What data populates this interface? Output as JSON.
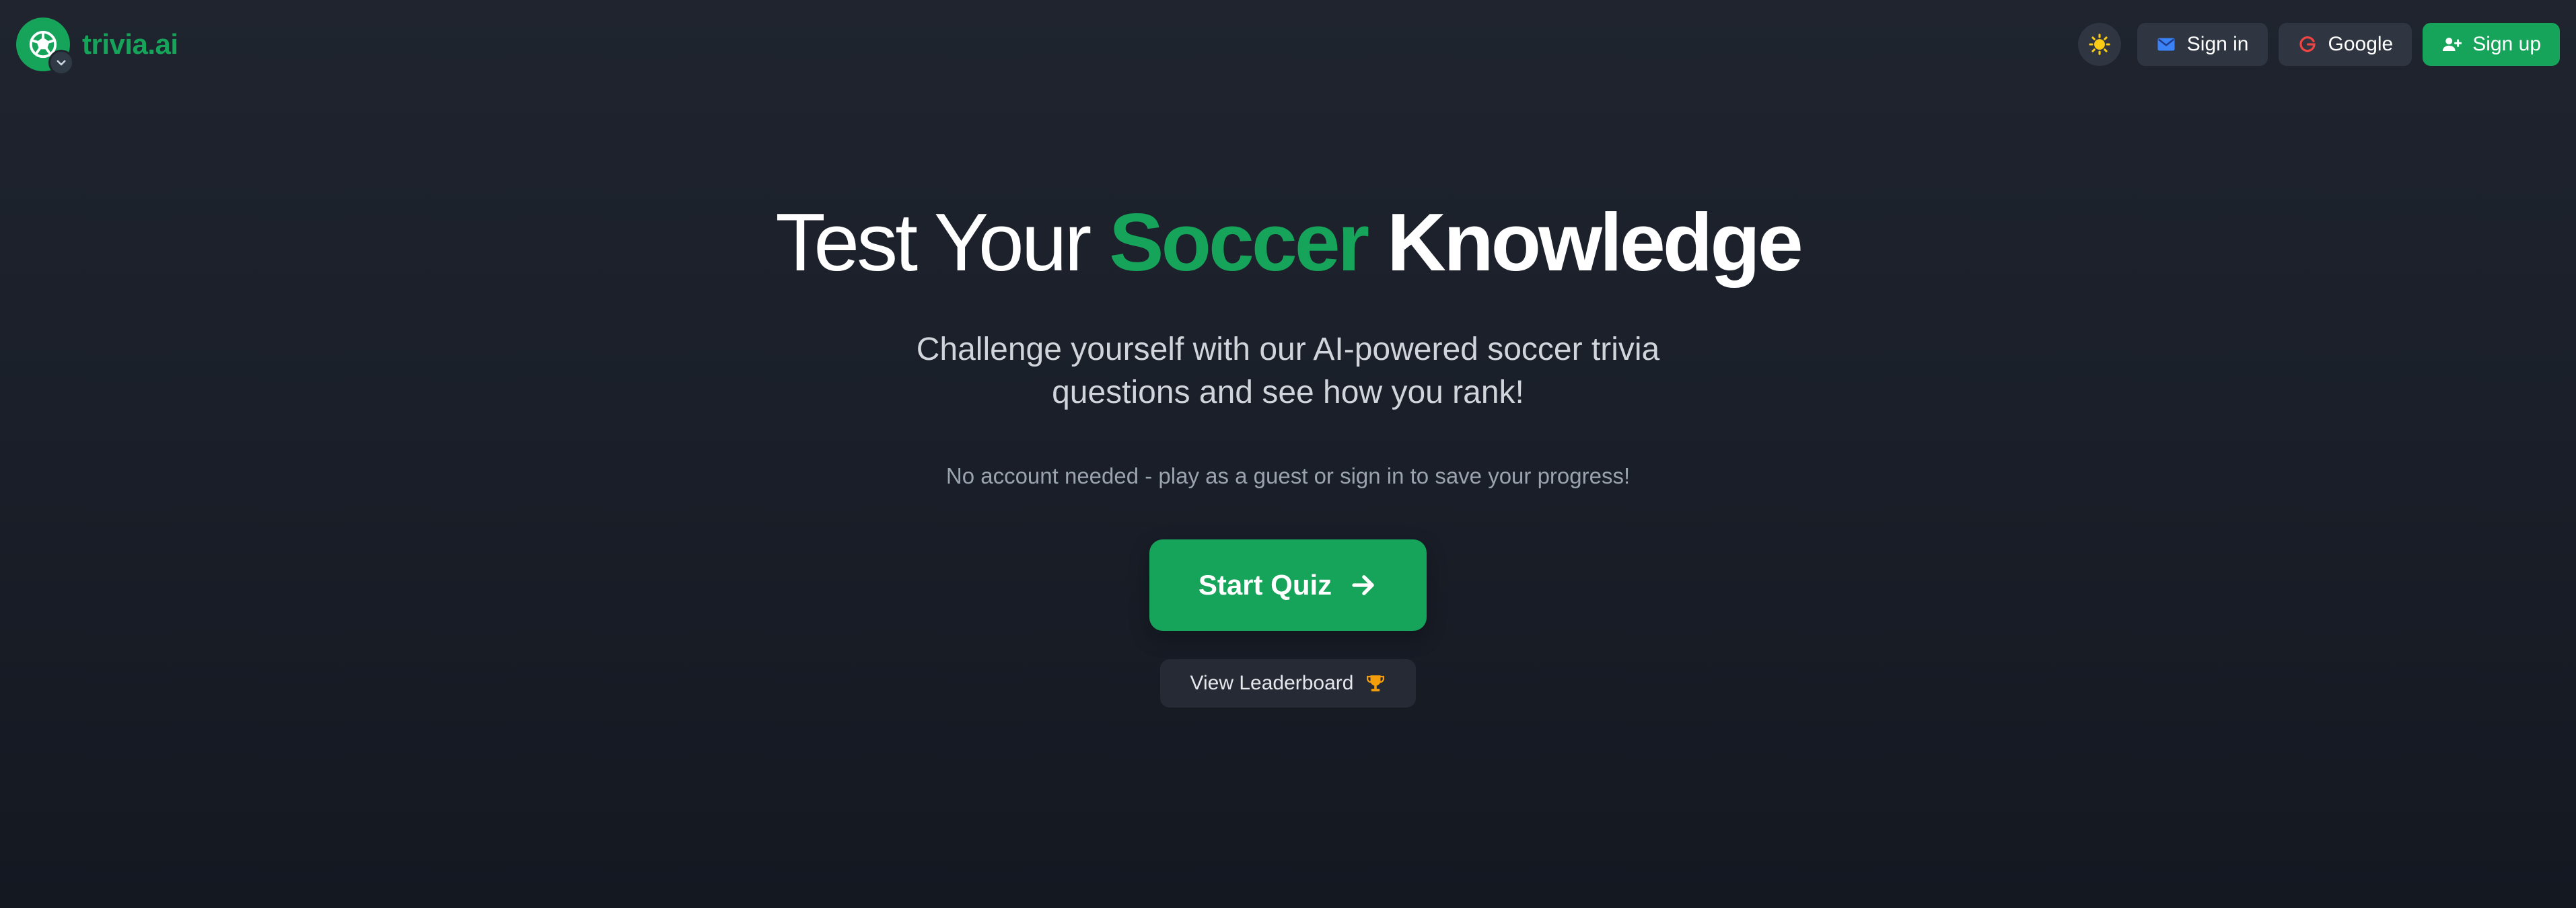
{
  "brand": {
    "name": "trivia.ai",
    "logo_icon": "soccer-ball-icon",
    "badge_icon": "chevron-down-icon"
  },
  "nav": {
    "theme_toggle_icon": "sun-icon",
    "sign_in": {
      "label": "Sign in",
      "icon": "mail-icon"
    },
    "google": {
      "label": "Google",
      "icon": "google-icon"
    },
    "sign_up": {
      "label": "Sign up",
      "icon": "user-plus-icon"
    }
  },
  "hero": {
    "title_part1": "Test Your",
    "title_accent": "Soccer",
    "title_part2": "Knowledge",
    "subtitle": "Challenge yourself with our AI-powered soccer trivia questions and see how you rank!",
    "guest_note": "No account needed - play as a guest or sign in to save your progress!",
    "start_button": {
      "label": "Start Quiz",
      "icon": "arrow-right-icon"
    },
    "leaderboard_button": {
      "label": "View Leaderboard",
      "icon": "trophy-icon"
    }
  },
  "colors": {
    "accent": "#16a35a",
    "background": "#1d222c",
    "button_surface": "#2f3541",
    "mail_icon": "#3b82f6",
    "google_icon": "#ef4444",
    "sun_icon": "#facc15",
    "trophy_icon": "#f59e0b"
  }
}
